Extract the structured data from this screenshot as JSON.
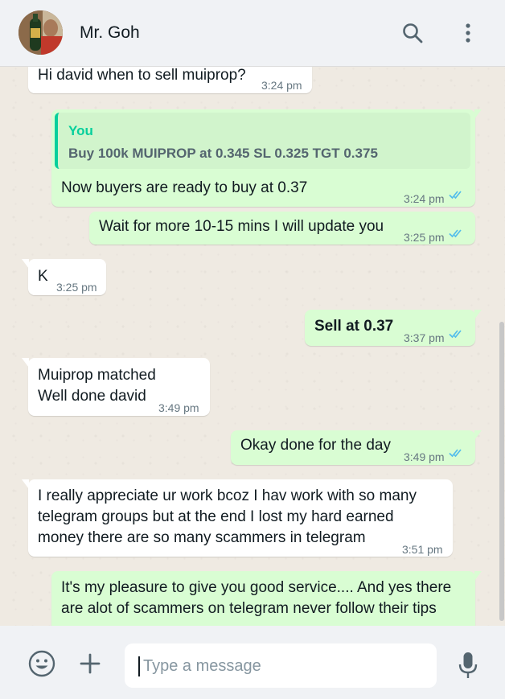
{
  "header": {
    "contact_name": "Mr. Goh"
  },
  "messages": [
    {
      "dir": "in",
      "text": "Hi david when to sell muiprop?",
      "time": "3:24 pm"
    },
    {
      "dir": "out",
      "quote_author": "You",
      "quote_text": "Buy 100k MUIPROP at 0.345 SL 0.325 TGT 0.375",
      "text": "Now buyers are ready to buy at 0.37",
      "time": "3:24 pm",
      "status": "read"
    },
    {
      "dir": "out",
      "text": "Wait for more 10-15 mins I will update you",
      "time": "3:25 pm",
      "status": "read"
    },
    {
      "dir": "in",
      "text": "K",
      "time": "3:25 pm"
    },
    {
      "dir": "out",
      "text": "Sell at 0.37",
      "time": "3:37 pm",
      "status": "read",
      "bold": true
    },
    {
      "dir": "in",
      "lines": [
        "Muiprop matched",
        "Well done david"
      ],
      "time": "3:49 pm"
    },
    {
      "dir": "out",
      "text": "Okay done for the day",
      "time": "3:49 pm",
      "status": "read"
    },
    {
      "dir": "in",
      "lines": [
        "I really appreciate ur work bcoz I hav work with so many",
        "telegram groups but at the end I lost my hard earned",
        "money there are so many scammers in telegram"
      ],
      "time": "3:51 pm"
    },
    {
      "dir": "out",
      "lines": [
        "It's my pleasure to give you good service.... And yes there",
        "are alot of scammers on telegram never follow their tips"
      ]
    }
  ],
  "composer": {
    "placeholder": "Type a message"
  },
  "icons": {
    "search": "search-icon",
    "menu": "more-vertical-icon",
    "emoji": "emoji-icon",
    "attach": "plus-icon",
    "mic": "microphone-icon"
  },
  "colors": {
    "outgoing_bubble": "#d9fdd3",
    "incoming_bubble": "#ffffff",
    "read_tick": "#53bdeb",
    "quote_accent": "#06cf9c",
    "chat_background": "#efeae2"
  }
}
